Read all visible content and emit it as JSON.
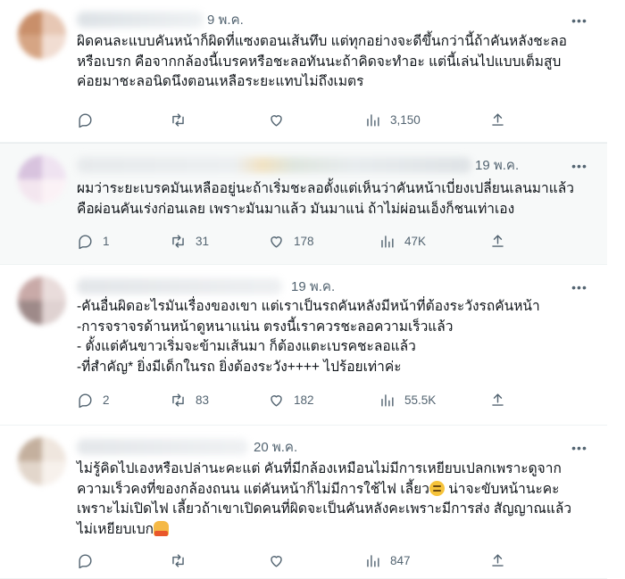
{
  "tweets": [
    {
      "date": "9 พ.ค.",
      "lines": [
        "ผิดคนละแบบคันหน้าก็ผิดที่แซงตอนเส้นทึบ แต่ทุกอย่างจะดีขึ้นกว่านี้ถ้าคันหลังชะลอ",
        "หรือเบรก คือจากกล้องนี้เบรคหรือชะลอทันนะถ้าคิดจะทำอะ แต่นี้เล่นไปแบบเต็มสูบ",
        "ค่อยมาชะลอนิดนึงตอนเหลือระยะแทบไม่ถึงเมตร"
      ],
      "replies": "",
      "retweets": "",
      "likes": "",
      "views": "3,150"
    },
    {
      "date": "19 พ.ค.",
      "lines": [
        "ผมว่าระยะเบรคมันเหลืออยู่นะถ้าเริ่มชะลอตั้งแต่เห็นว่าคันหน้าเบี่ยงเปลี่ยนเลนมาแล้ว",
        "คือผ่อนคันเร่งก่อนเลย เพราะมันมาแล้ว มันมาแน่ ถ้าไม่ผ่อนเอ็งก็ชนเท่าเอง"
      ],
      "replies": "1",
      "retweets": "31",
      "likes": "178",
      "views": "47K"
    },
    {
      "date": "19 พ.ค.",
      "lines": [
        "-คันอื่นผิดอะไรมันเรื่องของเขา แต่เราเป็นรถคันหลังมีหน้าที่ต้องระวังรถคันหน้า",
        "-การจราจรด้านหน้าดูหนาแน่น ตรงนี้เราควรชะลอความเร็วแล้ว",
        "- ตั้งแต่คันขาวเริ่มจะข้ามเส้นมา ก็ต้องแตะเบรคชะลอแล้ว",
        "-ที่สำคัญ* ยิ่งมีเด็กในรถ ยิ่งต้องระวัง++++ ไปร้อยเท่าค่ะ"
      ],
      "replies": "2",
      "retweets": "83",
      "likes": "182",
      "views": "55.5K"
    },
    {
      "date": "20 พ.ค.",
      "lines": [
        "ไม่รู้คิดไปเองหรือเปล่านะคะแต่ คันที่มีกล้องเหมือนไม่มีการเหยียบเปลกเพราะดูจาก",
        "ความเร็วคงที่ของกล้องถนน แต่คันหน้าก็ไม่มีการใช้ไฟ เลี้ยว",
        "เพราะไม่เปิดไฟ เลี้ยวถ้าเขาเปิดคนที่ผิดจะเป็นคันหลังคะเพราะมีการส่ง สัญญาณแล้ว",
        "ไม่เหยียบเบก"
      ],
      "line2_after_emoji": " น่าจะขับหน้านะคะ",
      "replies": "",
      "retweets": "",
      "likes": "",
      "views": "847"
    }
  ],
  "icons": [
    "reply-icon",
    "retweet-icon",
    "like-icon",
    "views-icon",
    "share-icon",
    "more-icon"
  ],
  "colors": {
    "text": "#0f1419",
    "muted": "#536471",
    "divider": "#eff3f4"
  }
}
